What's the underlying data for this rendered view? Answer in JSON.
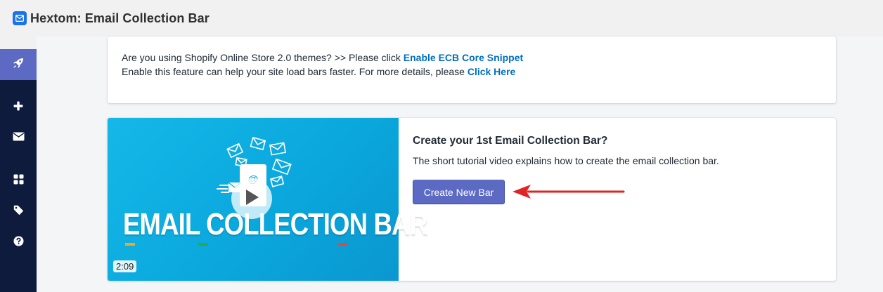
{
  "app": {
    "title": "Hextom: Email Collection Bar",
    "icon": "email-icon",
    "accent_color": "#5c6ac4",
    "sidebar_color": "#0f1b3d"
  },
  "sidebar": {
    "items": [
      {
        "icon": "rocket-icon",
        "active": true
      },
      {
        "icon": "plus-icon",
        "active": false
      },
      {
        "icon": "envelope-icon",
        "active": false
      },
      {
        "icon": "grid-icon",
        "active": false
      },
      {
        "icon": "tag-icon",
        "active": false
      },
      {
        "icon": "help-icon",
        "active": false
      }
    ]
  },
  "notice": {
    "line1_text": "Are you using Shopify Online Store 2.0 themes? >> Please click ",
    "line1_link": "Enable ECB Core Snippet",
    "line2_text": "Enable this feature can help your site load bars faster. For more details, please ",
    "line2_link": "Click Here",
    "link_color": "#0070c0"
  },
  "tutorial": {
    "video_title": "EMAIL COLLECTION BAR",
    "video_duration": "2:09",
    "heading": "Create your 1st Email Collection Bar?",
    "description": "The short tutorial video explains how to create the email collection bar.",
    "button_label": "Create New Bar",
    "arrow_color": "#e02424"
  }
}
